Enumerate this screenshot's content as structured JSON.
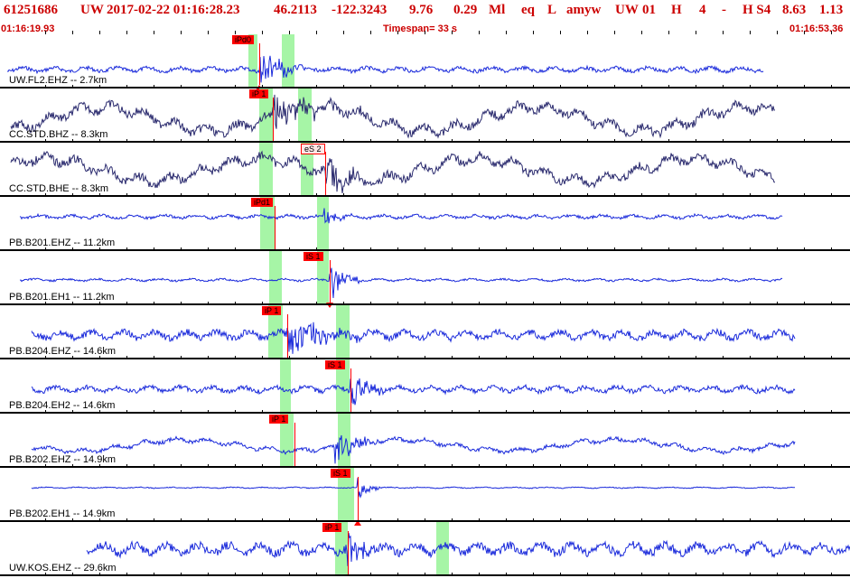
{
  "header": {
    "event_id": "61251686",
    "network": "UW",
    "datetime": "2017-02-22 01:16:28.23",
    "lat": "46.2113",
    "lon": "-122.3243",
    "depth": "9.76",
    "magnitude": "0.29",
    "mag_type": "Ml",
    "event_type": "eq",
    "location_flag": "L",
    "analyst": "amyw",
    "agency": "UW",
    "version": "01",
    "quality_flag": "H",
    "count": "4",
    "dash": "-",
    "solution": "H S4",
    "value1": "8.63",
    "value2": "1.13"
  },
  "subheader": {
    "start_time": "01:16:19.93",
    "timespan": "Timespan=  33 s",
    "end_time": "01:16:53.36"
  },
  "traces": [
    {
      "label": "UW.FL2.EHZ -- 2.7km",
      "color": "#1a2adb",
      "picks": [
        {
          "tag": "iPd0",
          "tri": "up"
        }
      ]
    },
    {
      "label": "CC.STD.BHZ -- 8.3km",
      "color": "#2a2a6e",
      "picks": [
        {
          "tag": "iP 1",
          "tri": "none"
        }
      ]
    },
    {
      "label": "CC.STD.BHE -- 8.3km",
      "color": "#2a2a6e",
      "picks": [
        {
          "tag": "eS 2",
          "tri": "none"
        }
      ]
    },
    {
      "label": "PB.B201.EHZ -- 11.2km",
      "color": "#1a2adb",
      "picks": [
        {
          "tag": "iPd1",
          "tri": "none"
        }
      ]
    },
    {
      "label": "PB.B201.EH1 -- 11.2km",
      "color": "#1a2adb",
      "picks": [
        {
          "tag": "iS 1",
          "tri": "down"
        }
      ]
    },
    {
      "label": "PB.B204.EHZ -- 14.6km",
      "color": "#1a2adb",
      "picks": [
        {
          "tag": "iP 1",
          "tri": "none"
        }
      ]
    },
    {
      "label": "PB.B204.EH2 -- 14.6km",
      "color": "#1a2adb",
      "picks": [
        {
          "tag": "iS 1",
          "tri": "none"
        }
      ]
    },
    {
      "label": "PB.B202.EHZ -- 14.9km",
      "color": "#1a2adb",
      "picks": [
        {
          "tag": "iP 1",
          "tri": "none"
        }
      ]
    },
    {
      "label": "PB.B202.EH1 -- 14.9km",
      "color": "#1a2adb",
      "picks": [
        {
          "tag": "iS 1",
          "tri": "up"
        }
      ]
    },
    {
      "label": "UW.KOS.EHZ -- 29.6km",
      "color": "#1a2adb",
      "picks": [
        {
          "tag": "iP 1",
          "tri": "none"
        }
      ]
    }
  ],
  "colors": {
    "header_text": "#cc0000",
    "pick": "#ff0000",
    "window": "#a6f5a6",
    "separator": "#000000"
  }
}
